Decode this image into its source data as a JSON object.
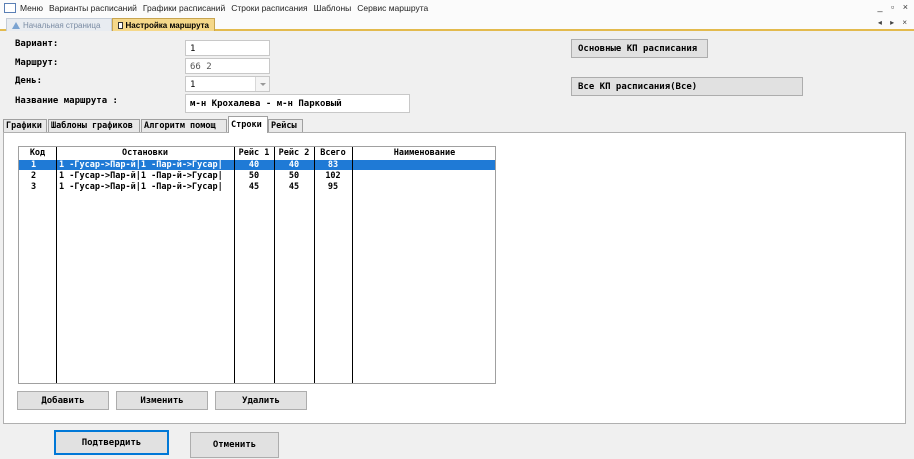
{
  "menubar": {
    "items": [
      "Меню",
      "Варианты расписаний",
      "Графики расписаний",
      "Строки расписания",
      "Шаблоны",
      "Сервис маршрута"
    ],
    "window_controls": "_ ▫ ×"
  },
  "doc_tabs": {
    "home": "Начальная страница",
    "active": "Настройка маршрута",
    "nav": "◂ ▸ ×"
  },
  "form": {
    "variant_label": "Вариант:",
    "variant_value": "1",
    "route_label": "Маршрут:",
    "route_value": "66  2",
    "day_label": "День:",
    "day_value": "1",
    "route_name_label": "Название маршрута :",
    "route_name_value": "м-н Крохалева - м-н Парковый"
  },
  "side_buttons": {
    "main_kp": "Основные КП расписания",
    "all_kp": "Все КП расписания(Все)"
  },
  "inner_tabs": [
    {
      "label": "Графики"
    },
    {
      "label": "Шаблоны графиков"
    },
    {
      "label": "Алгоритм помощ"
    },
    {
      "label": "Строки"
    },
    {
      "label": "Рейсы"
    }
  ],
  "grid": {
    "columns": [
      "Код",
      "Остановки",
      "Рейс 1",
      "Рейс 2",
      "Всего",
      "Наименование"
    ],
    "rows": [
      {
        "code": "1",
        "stops": "1 -Гусар->Пар-й|1 -Пар-й->Гусар|",
        "r1": "40",
        "r2": "40",
        "total": "83",
        "name": ""
      },
      {
        "code": "2",
        "stops": "1 -Гусар->Пар-й|1 -Пар-й->Гусар|",
        "r1": "50",
        "r2": "50",
        "total": "102",
        "name": ""
      },
      {
        "code": "3",
        "stops": "1 -Гусар->Пар-й|1 -Пар-й->Гусар|",
        "r1": "45",
        "r2": "45",
        "total": "95",
        "name": ""
      }
    ],
    "selected_row": 0
  },
  "grid_buttons": {
    "add": "Добавить",
    "edit": "Изменить",
    "delete": "Удалить"
  },
  "footer": {
    "confirm": "Подтвердить",
    "cancel": "Отменить"
  },
  "colors": {
    "selection": "#1f7ad6",
    "active_tab": "#f5d88a",
    "tab_underline": "#e3ba4d"
  }
}
